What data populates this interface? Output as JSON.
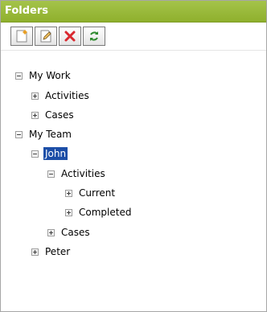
{
  "panel": {
    "title": "Folders"
  },
  "toolbar": {
    "buttons": [
      {
        "icon": "new-folder-icon"
      },
      {
        "icon": "edit-icon"
      },
      {
        "icon": "delete-icon"
      },
      {
        "icon": "refresh-icon"
      }
    ]
  },
  "tree": {
    "my_work": {
      "label": "My Work",
      "expanded": true
    },
    "my_work_activities": {
      "label": "Activities",
      "expanded": false
    },
    "my_work_cases": {
      "label": "Cases",
      "expanded": false
    },
    "my_team": {
      "label": "My Team",
      "expanded": true
    },
    "john": {
      "label": "John",
      "expanded": true,
      "selected": true
    },
    "john_activities": {
      "label": "Activities",
      "expanded": true
    },
    "john_activities_current": {
      "label": "Current",
      "expanded": false
    },
    "john_activities_completed": {
      "label": "Completed",
      "expanded": false
    },
    "john_cases": {
      "label": "Cases",
      "expanded": false
    },
    "peter": {
      "label": "Peter",
      "expanded": false
    }
  },
  "colors": {
    "title_bar": "#9bbb3c",
    "selection": "#1c4ea7"
  }
}
